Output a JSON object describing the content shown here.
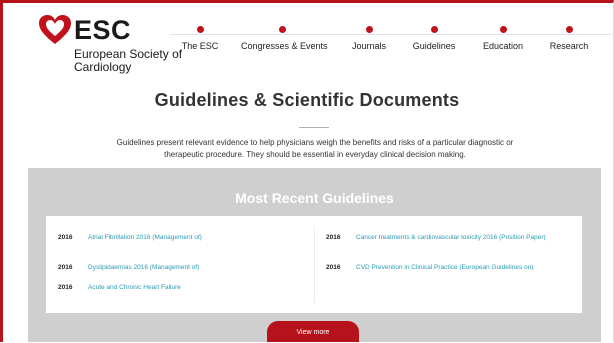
{
  "logo": {
    "acronym": "ESC",
    "name": "European Society of Cardiology"
  },
  "nav": [
    "The ESC",
    "Congresses & Events",
    "Journals",
    "Guidelines",
    "Education",
    "Research"
  ],
  "page": {
    "title": "Guidelines & Scientific Documents",
    "intro": "Guidelines present relevant evidence to help physicians weigh the benefits and risks of a particular diagnostic or therapeutic procedure. They should be essential in everyday clinical decision making."
  },
  "recent": {
    "title": "Most Recent Guidelines",
    "left": [
      {
        "year": "2016",
        "label": "Atrial Fibrillation 2016 (Management of)"
      },
      {
        "year": "2016",
        "label": "Dyslipidaemias 2016 (Management of)"
      },
      {
        "year": "2016",
        "label": "Acute and Chronic Heart Failure"
      }
    ],
    "right": [
      {
        "year": "2016",
        "label": "Cancer treatments & cardiovascular toxicity 2016 (Position Paper)"
      },
      {
        "year": "2016",
        "label": "CVD Prevention in Clinical Practice (European Guidelines on)"
      }
    ],
    "button": "View more"
  },
  "colors": {
    "brand": "#b5121b",
    "link": "#2a9bb4",
    "panel": "#cfcfcf"
  }
}
